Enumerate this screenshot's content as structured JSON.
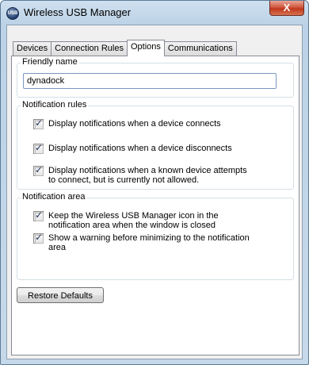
{
  "window": {
    "title": "Wireless USB Manager",
    "close_label": "X",
    "icon": "wireless-usb-icon"
  },
  "tabs": [
    {
      "label": "Devices",
      "active": false
    },
    {
      "label": "Connection Rules",
      "active": false
    },
    {
      "label": "Options",
      "active": true
    },
    {
      "label": "Communications",
      "active": false
    }
  ],
  "friendly_name": {
    "legend": "Friendly name",
    "value": "dynadock"
  },
  "notification_rules": {
    "legend": "Notification rules",
    "items": [
      {
        "checked": true,
        "lines": [
          "Display notifications when a device connects"
        ]
      },
      {
        "checked": true,
        "lines": [
          "Display notifications when a device disconnects"
        ]
      },
      {
        "checked": true,
        "lines": [
          "Display notifications when a known device attempts",
          "to connect, but is currently not allowed."
        ]
      }
    ]
  },
  "notification_area": {
    "legend": "Notification area",
    "items": [
      {
        "checked": true,
        "lines": [
          "Keep the Wireless USB Manager icon in the",
          "notification area when the window is closed"
        ]
      },
      {
        "checked": true,
        "lines": [
          "Show a warning before minimizing to the notification",
          "area"
        ]
      }
    ]
  },
  "restore_button": "Restore Defaults",
  "colors": {
    "title_bar": "#bcd2e6",
    "close_button": "#c0381f",
    "checkmark": "#1b2e5c"
  }
}
